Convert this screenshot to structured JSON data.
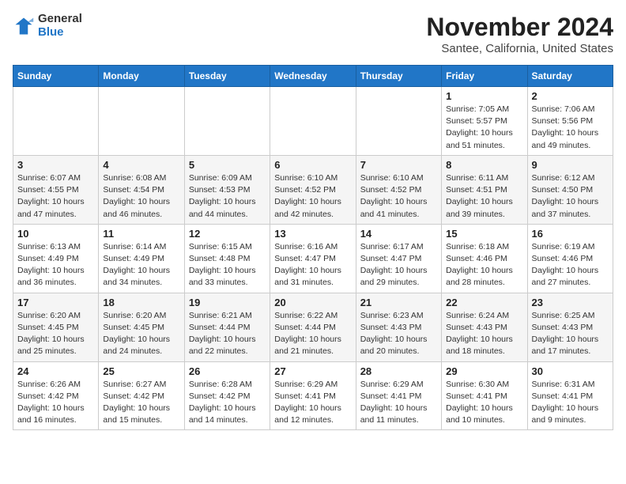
{
  "logo": {
    "general": "General",
    "blue": "Blue"
  },
  "title": "November 2024",
  "subtitle": "Santee, California, United States",
  "days_header": [
    "Sunday",
    "Monday",
    "Tuesday",
    "Wednesday",
    "Thursday",
    "Friday",
    "Saturday"
  ],
  "weeks": [
    [
      {
        "day": "",
        "info": ""
      },
      {
        "day": "",
        "info": ""
      },
      {
        "day": "",
        "info": ""
      },
      {
        "day": "",
        "info": ""
      },
      {
        "day": "",
        "info": ""
      },
      {
        "day": "1",
        "info": "Sunrise: 7:05 AM\nSunset: 5:57 PM\nDaylight: 10 hours and 51 minutes."
      },
      {
        "day": "2",
        "info": "Sunrise: 7:06 AM\nSunset: 5:56 PM\nDaylight: 10 hours and 49 minutes."
      }
    ],
    [
      {
        "day": "3",
        "info": "Sunrise: 6:07 AM\nSunset: 4:55 PM\nDaylight: 10 hours and 47 minutes."
      },
      {
        "day": "4",
        "info": "Sunrise: 6:08 AM\nSunset: 4:54 PM\nDaylight: 10 hours and 46 minutes."
      },
      {
        "day": "5",
        "info": "Sunrise: 6:09 AM\nSunset: 4:53 PM\nDaylight: 10 hours and 44 minutes."
      },
      {
        "day": "6",
        "info": "Sunrise: 6:10 AM\nSunset: 4:52 PM\nDaylight: 10 hours and 42 minutes."
      },
      {
        "day": "7",
        "info": "Sunrise: 6:10 AM\nSunset: 4:52 PM\nDaylight: 10 hours and 41 minutes."
      },
      {
        "day": "8",
        "info": "Sunrise: 6:11 AM\nSunset: 4:51 PM\nDaylight: 10 hours and 39 minutes."
      },
      {
        "day": "9",
        "info": "Sunrise: 6:12 AM\nSunset: 4:50 PM\nDaylight: 10 hours and 37 minutes."
      }
    ],
    [
      {
        "day": "10",
        "info": "Sunrise: 6:13 AM\nSunset: 4:49 PM\nDaylight: 10 hours and 36 minutes."
      },
      {
        "day": "11",
        "info": "Sunrise: 6:14 AM\nSunset: 4:49 PM\nDaylight: 10 hours and 34 minutes."
      },
      {
        "day": "12",
        "info": "Sunrise: 6:15 AM\nSunset: 4:48 PM\nDaylight: 10 hours and 33 minutes."
      },
      {
        "day": "13",
        "info": "Sunrise: 6:16 AM\nSunset: 4:47 PM\nDaylight: 10 hours and 31 minutes."
      },
      {
        "day": "14",
        "info": "Sunrise: 6:17 AM\nSunset: 4:47 PM\nDaylight: 10 hours and 29 minutes."
      },
      {
        "day": "15",
        "info": "Sunrise: 6:18 AM\nSunset: 4:46 PM\nDaylight: 10 hours and 28 minutes."
      },
      {
        "day": "16",
        "info": "Sunrise: 6:19 AM\nSunset: 4:46 PM\nDaylight: 10 hours and 27 minutes."
      }
    ],
    [
      {
        "day": "17",
        "info": "Sunrise: 6:20 AM\nSunset: 4:45 PM\nDaylight: 10 hours and 25 minutes."
      },
      {
        "day": "18",
        "info": "Sunrise: 6:20 AM\nSunset: 4:45 PM\nDaylight: 10 hours and 24 minutes."
      },
      {
        "day": "19",
        "info": "Sunrise: 6:21 AM\nSunset: 4:44 PM\nDaylight: 10 hours and 22 minutes."
      },
      {
        "day": "20",
        "info": "Sunrise: 6:22 AM\nSunset: 4:44 PM\nDaylight: 10 hours and 21 minutes."
      },
      {
        "day": "21",
        "info": "Sunrise: 6:23 AM\nSunset: 4:43 PM\nDaylight: 10 hours and 20 minutes."
      },
      {
        "day": "22",
        "info": "Sunrise: 6:24 AM\nSunset: 4:43 PM\nDaylight: 10 hours and 18 minutes."
      },
      {
        "day": "23",
        "info": "Sunrise: 6:25 AM\nSunset: 4:43 PM\nDaylight: 10 hours and 17 minutes."
      }
    ],
    [
      {
        "day": "24",
        "info": "Sunrise: 6:26 AM\nSunset: 4:42 PM\nDaylight: 10 hours and 16 minutes."
      },
      {
        "day": "25",
        "info": "Sunrise: 6:27 AM\nSunset: 4:42 PM\nDaylight: 10 hours and 15 minutes."
      },
      {
        "day": "26",
        "info": "Sunrise: 6:28 AM\nSunset: 4:42 PM\nDaylight: 10 hours and 14 minutes."
      },
      {
        "day": "27",
        "info": "Sunrise: 6:29 AM\nSunset: 4:41 PM\nDaylight: 10 hours and 12 minutes."
      },
      {
        "day": "28",
        "info": "Sunrise: 6:29 AM\nSunset: 4:41 PM\nDaylight: 10 hours and 11 minutes."
      },
      {
        "day": "29",
        "info": "Sunrise: 6:30 AM\nSunset: 4:41 PM\nDaylight: 10 hours and 10 minutes."
      },
      {
        "day": "30",
        "info": "Sunrise: 6:31 AM\nSunset: 4:41 PM\nDaylight: 10 hours and 9 minutes."
      }
    ]
  ]
}
